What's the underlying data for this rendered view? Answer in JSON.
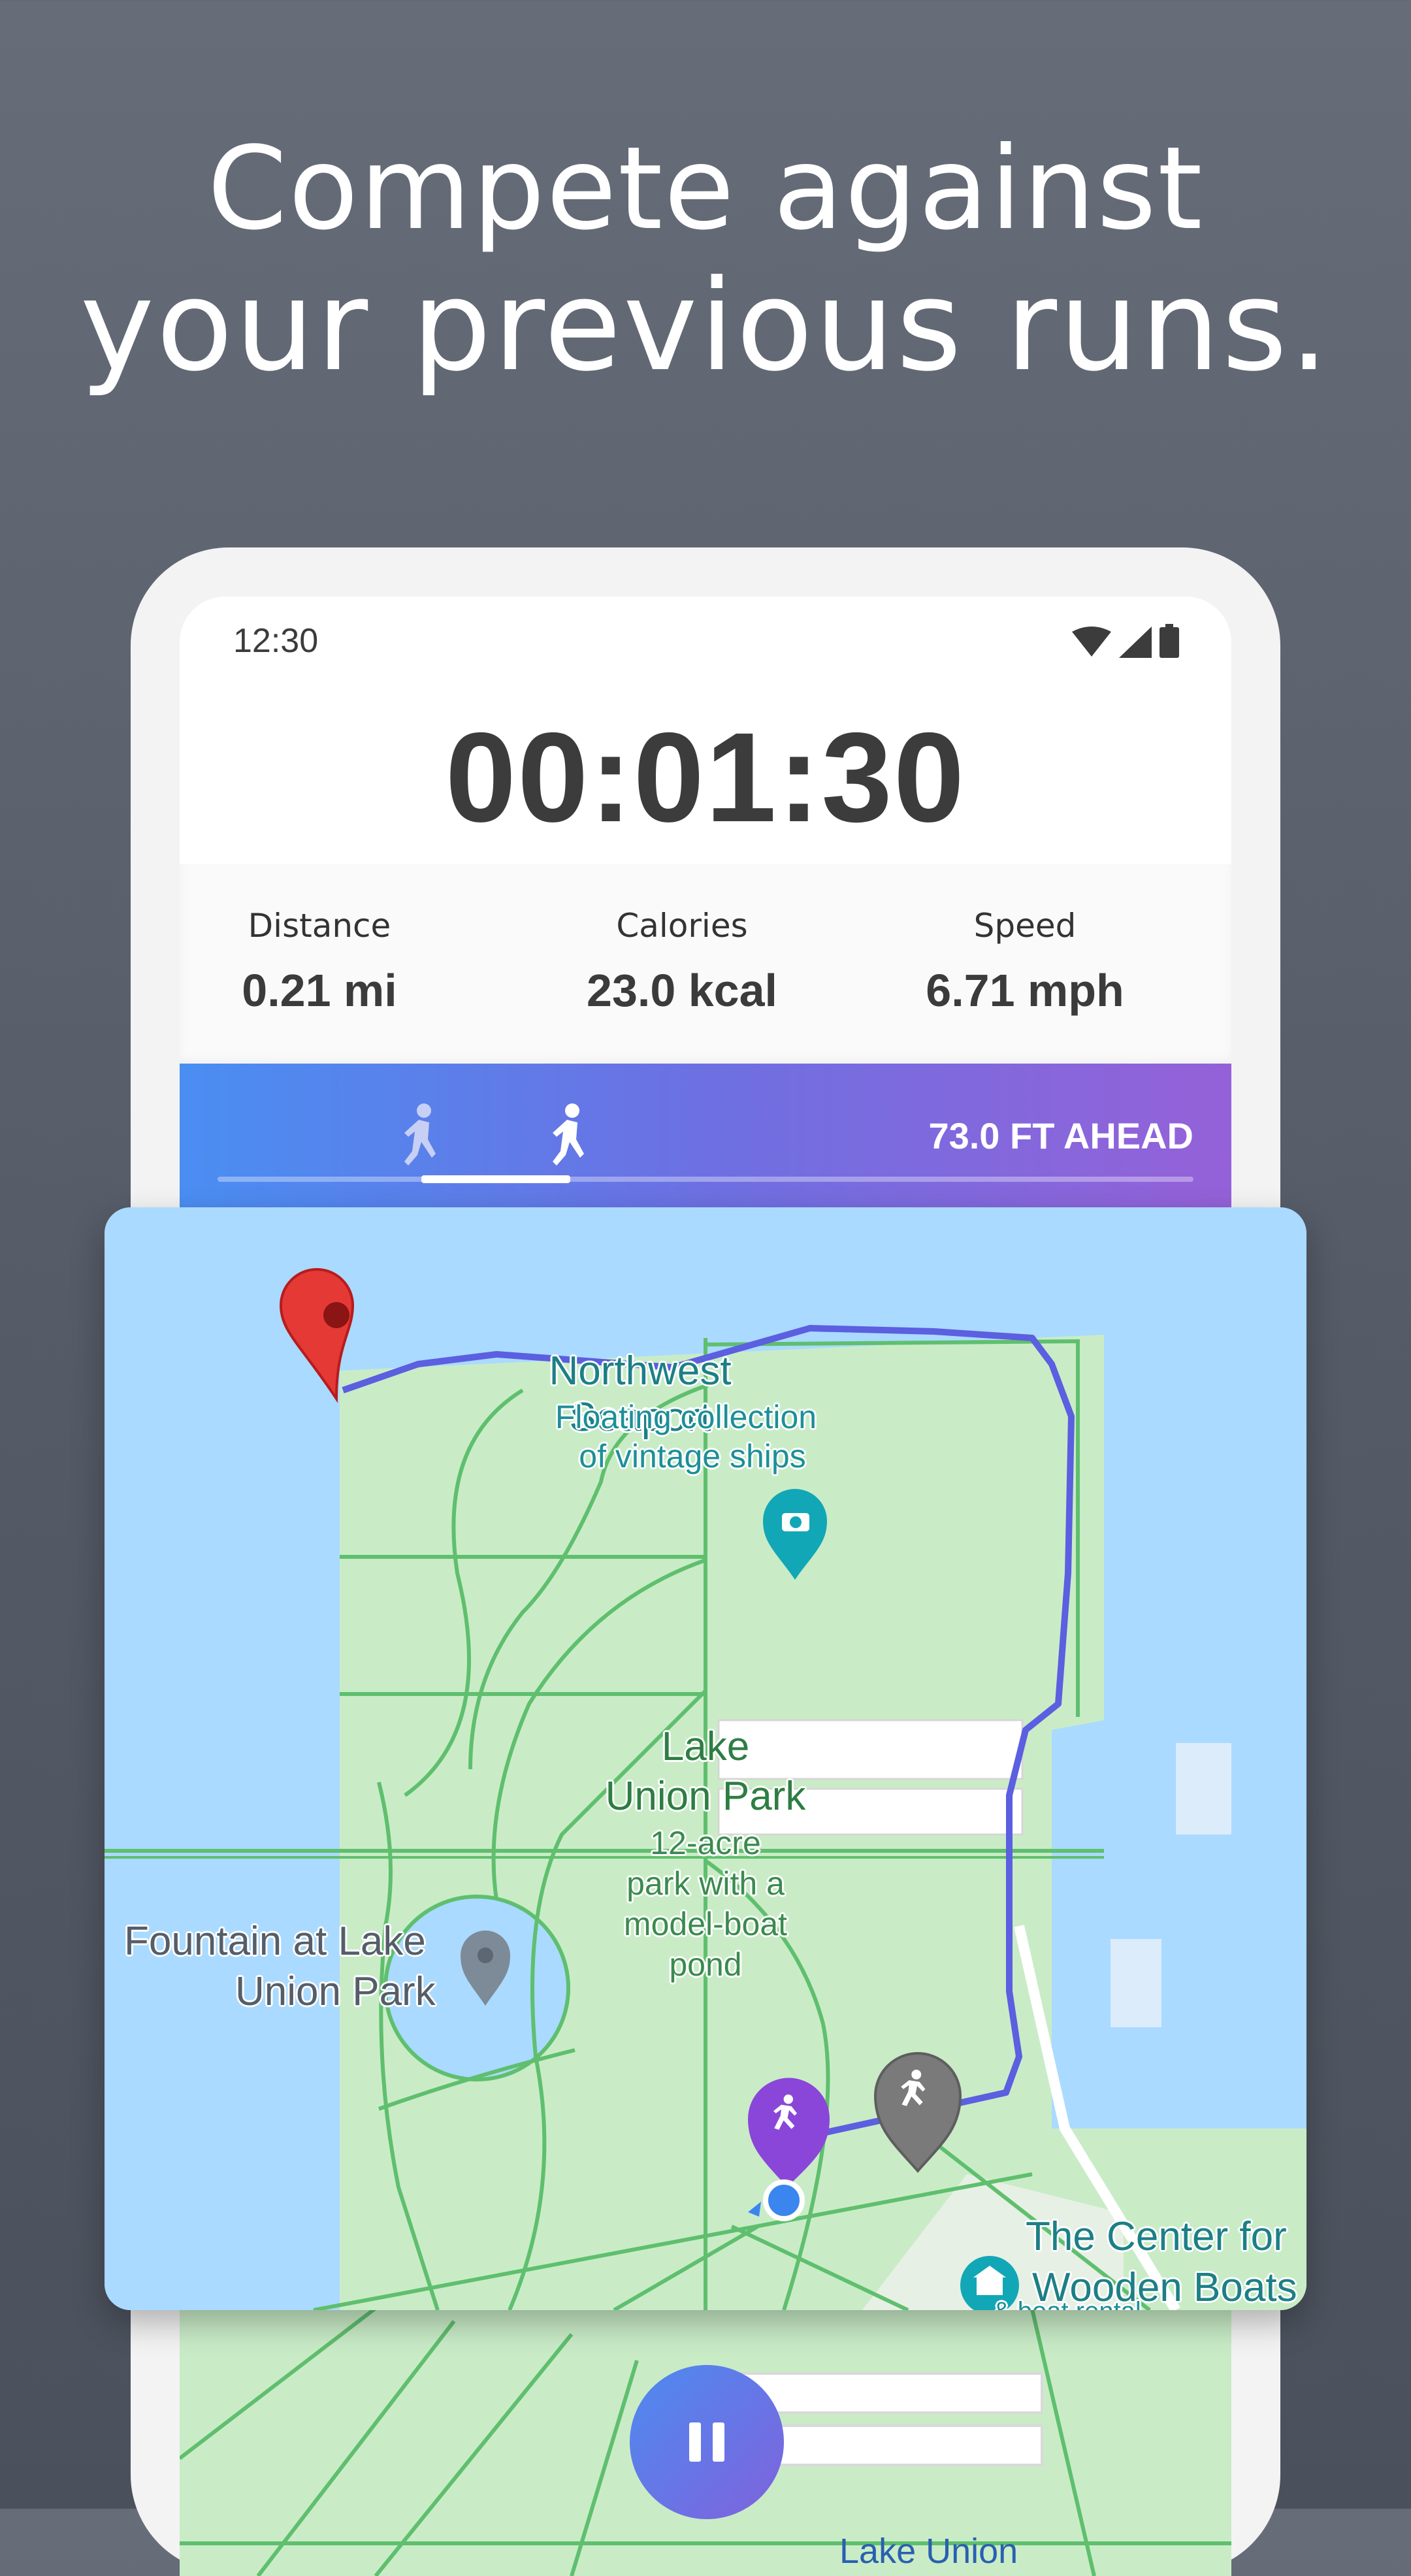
{
  "headline": {
    "line1": "Compete against",
    "line2": "your previous runs."
  },
  "status_bar": {
    "time": "12:30",
    "icons": [
      "wifi-icon",
      "signal-icon",
      "battery-icon"
    ]
  },
  "run": {
    "timer": "00:01:30",
    "stats": [
      {
        "label": "Distance",
        "value": "0.21 mi"
      },
      {
        "label": "Calories",
        "value": "23.0 kcal"
      },
      {
        "label": "Speed",
        "value": "6.71 mph"
      }
    ],
    "ghost": {
      "status": "73.0 FT AHEAD"
    }
  },
  "map": {
    "poi_seaport": {
      "name": "Northwest Seaport",
      "desc1": "Floating collection",
      "desc2": "of vintage ships"
    },
    "park": {
      "name1": "Lake",
      "name2": "Union Park",
      "desc1": "12-acre",
      "desc2": "park with a",
      "desc3": "model-boat",
      "desc4": "pond"
    },
    "fountain": {
      "name1": "Fountain at Lake",
      "name2": "Union Park"
    },
    "center": {
      "name1": "The Center for",
      "name2": "Wooden Boats",
      "desc": "& boat rental"
    },
    "lake_label": "Lake Union",
    "colors": {
      "water": "#aadaff",
      "park": "#c9ecc7",
      "path": "#5fbf6e",
      "route": "#5b5fe0",
      "ghost": "#8a46d8",
      "start_pin": "#e53935"
    }
  },
  "controls": {
    "pause_icon": "pause-icon"
  }
}
